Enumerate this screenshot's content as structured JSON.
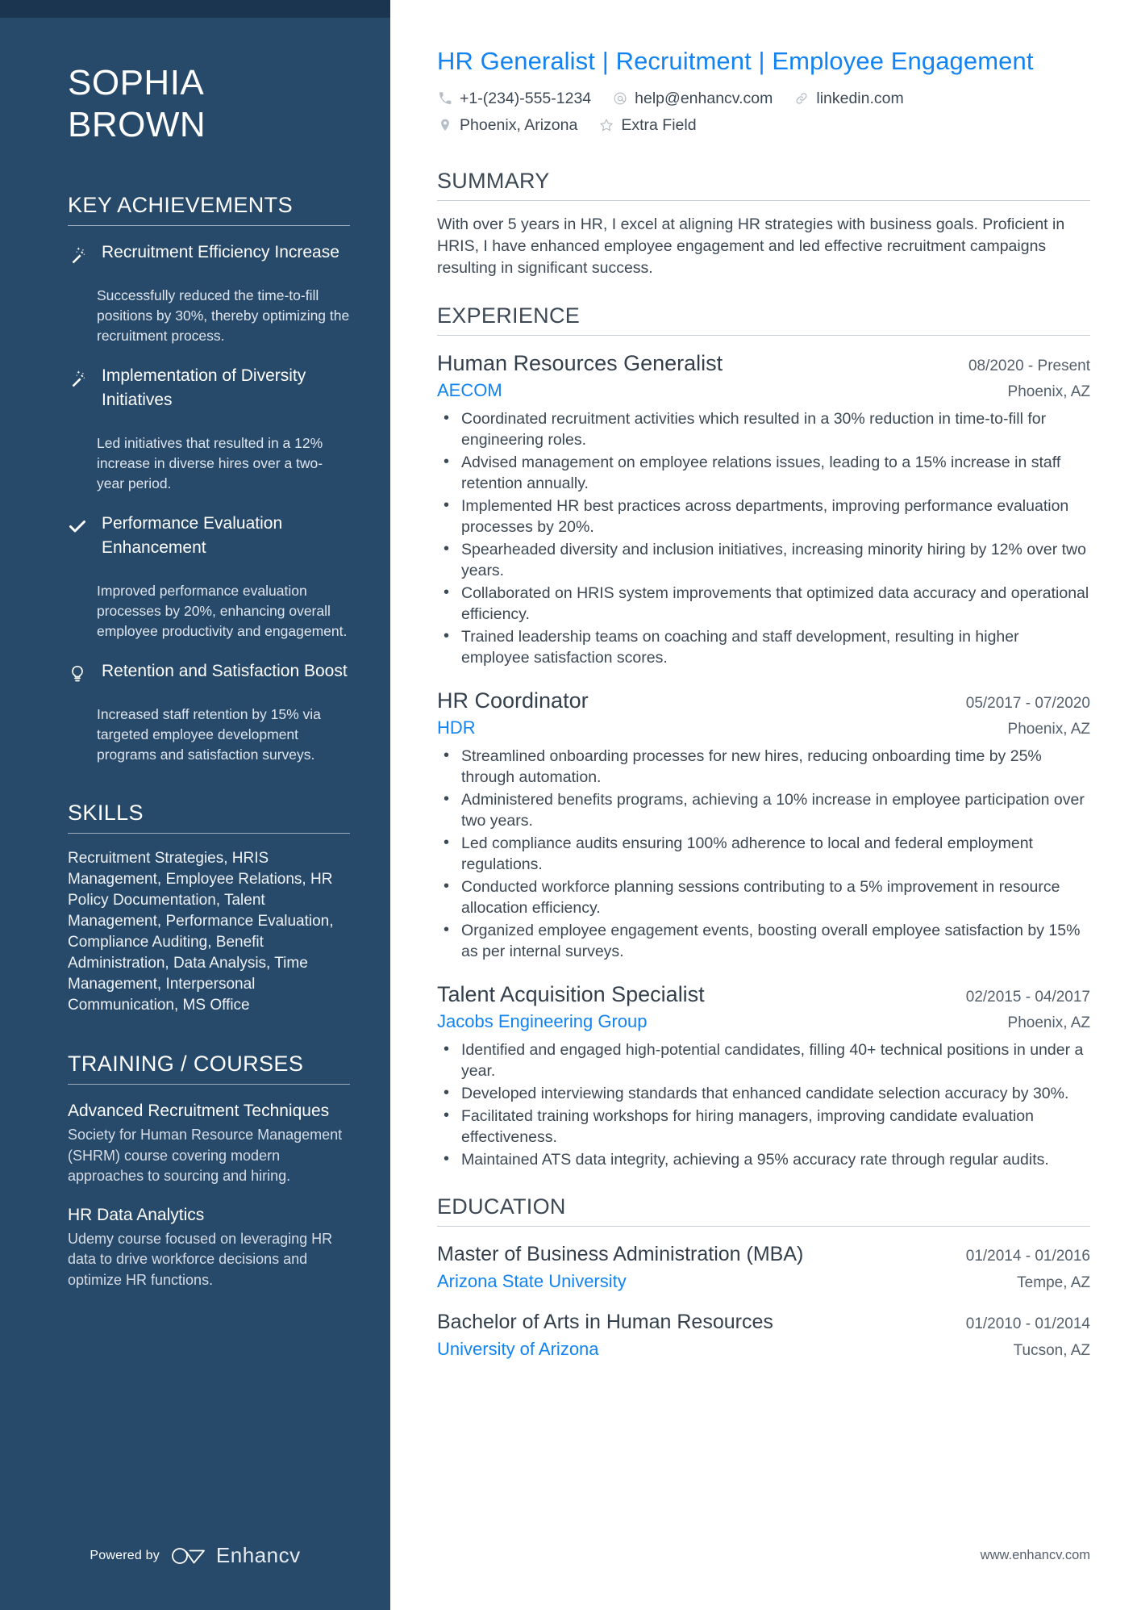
{
  "person": {
    "first_name": "SOPHIA",
    "last_name": "BROWN",
    "headline_part1": "HR Generalist",
    "headline_sep1": "|",
    "headline_part2": "Recruitment",
    "headline_sep2": "|",
    "headline_part3": "Employee Engagement"
  },
  "colors": {
    "sidebar_bg": "#27496a",
    "sidebar_topbar": "#1b3450",
    "accent_blue": "#1283f0",
    "body_text": "#3c4854"
  },
  "contact": {
    "row1": [
      {
        "icon": "phone-icon",
        "value": "+1-(234)-555-1234"
      },
      {
        "icon": "email-icon",
        "value": "help@enhancv.com"
      },
      {
        "icon": "link-icon",
        "value": "linkedin.com"
      }
    ],
    "row2": [
      {
        "icon": "location-pin-icon",
        "value": "Phoenix, Arizona"
      },
      {
        "icon": "star-icon",
        "value": "Extra Field"
      }
    ]
  },
  "sidebar": {
    "achievements_title": "KEY ACHIEVEMENTS",
    "achievements": [
      {
        "icon": "magic-wand-icon",
        "title": "Recruitment Efficiency Increase",
        "description": "Successfully reduced the time-to-fill positions by 30%, thereby optimizing the recruitment process."
      },
      {
        "icon": "magic-wand-icon",
        "title": "Implementation of Diversity Initiatives",
        "description": "Led initiatives that resulted in a 12% increase in diverse hires over a two-year period."
      },
      {
        "icon": "check-icon",
        "title": "Performance Evaluation Enhancement",
        "description": "Improved performance evaluation processes by 20%, enhancing overall employee productivity and engagement."
      },
      {
        "icon": "lightbulb-icon",
        "title": "Retention and Satisfaction Boost",
        "description": "Increased staff retention by 15% via targeted employee development programs and satisfaction surveys."
      }
    ],
    "skills_title": "SKILLS",
    "skills_text": "Recruitment Strategies, HRIS Management, Employee Relations, HR Policy Documentation, Talent Management, Performance Evaluation, Compliance Auditing, Benefit Administration, Data Analysis, Time Management, Interpersonal Communication, MS Office",
    "training_title": "TRAINING / COURSES",
    "courses": [
      {
        "title": "Advanced Recruitment Techniques",
        "description": "Society for Human Resource Management (SHRM) course covering modern approaches to sourcing and hiring."
      },
      {
        "title": "HR Data Analytics",
        "description": "Udemy course focused on leveraging HR data to drive workforce decisions and optimize HR functions."
      }
    ],
    "powered_by": "Powered by",
    "brand": "Enhancv"
  },
  "main": {
    "summary_title": "SUMMARY",
    "summary_text": "With over 5 years in HR, I excel at aligning HR strategies with business goals. Proficient in HRIS, I have enhanced employee engagement and led effective recruitment campaigns resulting in significant success.",
    "experience_title": "EXPERIENCE",
    "jobs": [
      {
        "title": "Human Resources Generalist",
        "dates": "08/2020 - Present",
        "company": "AECOM",
        "location": "Phoenix, AZ",
        "bullets": [
          "Coordinated recruitment activities which resulted in a 30% reduction in time-to-fill for engineering roles.",
          "Advised management on employee relations issues, leading to a 15% increase in staff retention annually.",
          "Implemented HR best practices across departments, improving performance evaluation processes by 20%.",
          "Spearheaded diversity and inclusion initiatives, increasing minority hiring by 12% over two years.",
          "Collaborated on HRIS system improvements that optimized data accuracy and operational efficiency.",
          "Trained leadership teams on coaching and staff development, resulting in higher employee satisfaction scores."
        ]
      },
      {
        "title": "HR Coordinator",
        "dates": "05/2017 - 07/2020",
        "company": "HDR",
        "location": "Phoenix, AZ",
        "bullets": [
          "Streamlined onboarding processes for new hires, reducing onboarding time by 25% through automation.",
          "Administered benefits programs, achieving a 10% increase in employee participation over two years.",
          "Led compliance audits ensuring 100% adherence to local and federal employment regulations.",
          "Conducted workforce planning sessions contributing to a 5% improvement in resource allocation efficiency.",
          "Organized employee engagement events, boosting overall employee satisfaction by 15% as per internal surveys."
        ]
      },
      {
        "title": "Talent Acquisition Specialist",
        "dates": "02/2015 - 04/2017",
        "company": "Jacobs Engineering Group",
        "location": "Phoenix, AZ",
        "bullets": [
          "Identified and engaged high-potential candidates, filling 40+ technical positions in under a year.",
          "Developed interviewing standards that enhanced candidate selection accuracy by 30%.",
          "Facilitated training workshops for hiring managers, improving candidate evaluation effectiveness.",
          "Maintained ATS data integrity, achieving a 95% accuracy rate through regular audits."
        ]
      }
    ],
    "education_title": "EDUCATION",
    "education": [
      {
        "degree": "Master of Business Administration (MBA)",
        "dates": "01/2014 - 01/2016",
        "school": "Arizona State University",
        "location": "Tempe, AZ"
      },
      {
        "degree": "Bachelor of Arts in Human Resources",
        "dates": "01/2010 - 01/2014",
        "school": "University of Arizona",
        "location": "Tucson, AZ"
      }
    ],
    "footer_url": "www.enhancv.com"
  }
}
